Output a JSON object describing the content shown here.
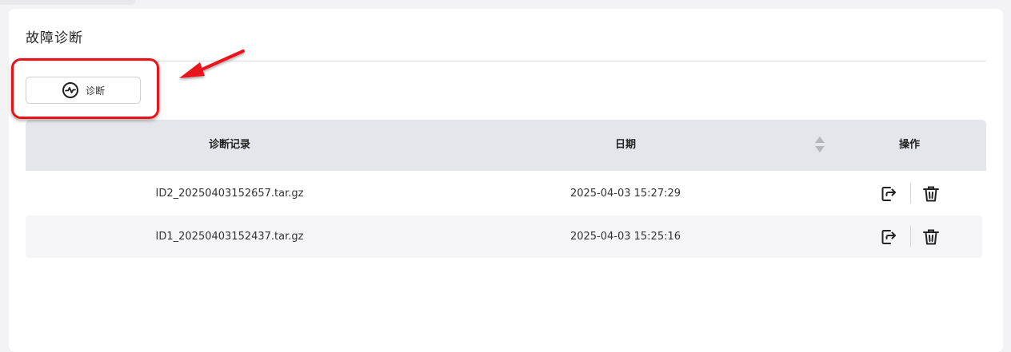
{
  "page": {
    "title": "故障诊断"
  },
  "toolbar": {
    "diagnose_label": "诊断",
    "diagnose_icon": "pulse-circle-icon"
  },
  "annotation": {
    "highlight_color": "#e8121b"
  },
  "table": {
    "columns": {
      "record": "诊断记录",
      "date": "日期",
      "actions": "操作"
    },
    "sort_icon": "sort-updown-icon",
    "rows": [
      {
        "record": "ID2_20250403152657.tar.gz",
        "date": "2025-04-03 15:27:29"
      },
      {
        "record": "ID1_20250403152437.tar.gz",
        "date": "2025-04-03 15:25:16"
      }
    ],
    "row_actions": {
      "export_icon": "export-icon",
      "delete_icon": "trash-icon"
    }
  }
}
